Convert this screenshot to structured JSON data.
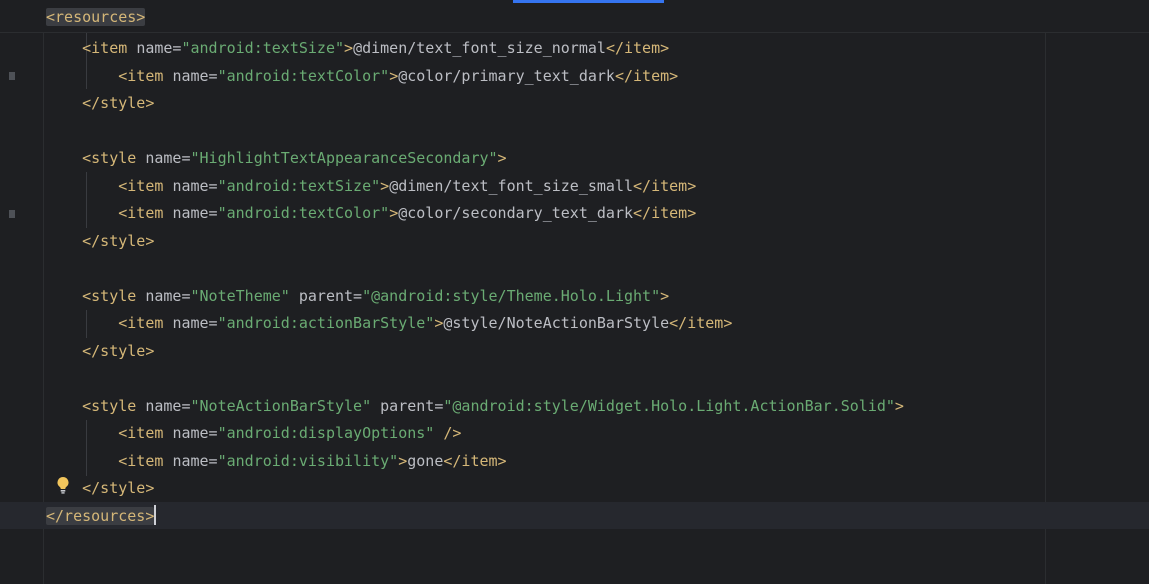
{
  "editor": {
    "header_line": [
      {
        "cls": "t tag-hl",
        "text": "<resources>"
      }
    ],
    "lines": [
      [
        {
          "cls": "x",
          "text": "    "
        },
        {
          "cls": "t",
          "text": "<item "
        },
        {
          "cls": "a",
          "text": "name="
        },
        {
          "cls": "v",
          "text": "\"android:textSize\""
        },
        {
          "cls": "t",
          "text": ">"
        },
        {
          "cls": "x",
          "text": "@dimen/text_font_size_normal"
        },
        {
          "cls": "t",
          "text": "</item>"
        }
      ],
      [
        {
          "cls": "x",
          "text": "        "
        },
        {
          "cls": "t",
          "text": "<item "
        },
        {
          "cls": "a",
          "text": "name="
        },
        {
          "cls": "v",
          "text": "\"android:textColor\""
        },
        {
          "cls": "t",
          "text": ">"
        },
        {
          "cls": "x",
          "text": "@color/primary_text_dark"
        },
        {
          "cls": "t",
          "text": "</item>"
        }
      ],
      [
        {
          "cls": "x",
          "text": "    "
        },
        {
          "cls": "t",
          "text": "</style>"
        }
      ],
      [],
      [
        {
          "cls": "x",
          "text": "    "
        },
        {
          "cls": "t",
          "text": "<style "
        },
        {
          "cls": "a",
          "text": "name="
        },
        {
          "cls": "v",
          "text": "\"HighlightTextAppearanceSecondary\""
        },
        {
          "cls": "t",
          "text": ">"
        }
      ],
      [
        {
          "cls": "x",
          "text": "        "
        },
        {
          "cls": "t",
          "text": "<item "
        },
        {
          "cls": "a",
          "text": "name="
        },
        {
          "cls": "v",
          "text": "\"android:textSize\""
        },
        {
          "cls": "t",
          "text": ">"
        },
        {
          "cls": "x",
          "text": "@dimen/text_font_size_small"
        },
        {
          "cls": "t",
          "text": "</item>"
        }
      ],
      [
        {
          "cls": "x",
          "text": "        "
        },
        {
          "cls": "t",
          "text": "<item "
        },
        {
          "cls": "a",
          "text": "name="
        },
        {
          "cls": "v",
          "text": "\"android:textColor\""
        },
        {
          "cls": "t",
          "text": ">"
        },
        {
          "cls": "x",
          "text": "@color/secondary_text_dark"
        },
        {
          "cls": "t",
          "text": "</item>"
        }
      ],
      [
        {
          "cls": "x",
          "text": "    "
        },
        {
          "cls": "t",
          "text": "</style>"
        }
      ],
      [],
      [
        {
          "cls": "x",
          "text": "    "
        },
        {
          "cls": "t",
          "text": "<style "
        },
        {
          "cls": "a",
          "text": "name="
        },
        {
          "cls": "v",
          "text": "\"NoteTheme\""
        },
        {
          "cls": "a",
          "text": " parent="
        },
        {
          "cls": "v",
          "text": "\"@android:style/Theme.Holo.Light\""
        },
        {
          "cls": "t",
          "text": ">"
        }
      ],
      [
        {
          "cls": "x",
          "text": "        "
        },
        {
          "cls": "t",
          "text": "<item "
        },
        {
          "cls": "a",
          "text": "name="
        },
        {
          "cls": "v",
          "text": "\"android:actionBarStyle\""
        },
        {
          "cls": "t",
          "text": ">"
        },
        {
          "cls": "x",
          "text": "@style/NoteActionBarStyle"
        },
        {
          "cls": "t",
          "text": "</item>"
        }
      ],
      [
        {
          "cls": "x",
          "text": "    "
        },
        {
          "cls": "t",
          "text": "</style>"
        }
      ],
      [],
      [
        {
          "cls": "x",
          "text": "    "
        },
        {
          "cls": "t",
          "text": "<style "
        },
        {
          "cls": "a",
          "text": "name="
        },
        {
          "cls": "v",
          "text": "\"NoteActionBarStyle\""
        },
        {
          "cls": "a",
          "text": " parent="
        },
        {
          "cls": "v",
          "text": "\"@android:style/Widget.Holo.Light.ActionBar.Solid\""
        },
        {
          "cls": "t",
          "text": ">"
        }
      ],
      [
        {
          "cls": "x",
          "text": "        "
        },
        {
          "cls": "t",
          "text": "<item "
        },
        {
          "cls": "a",
          "text": "name="
        },
        {
          "cls": "v",
          "text": "\"android:displayOptions\""
        },
        {
          "cls": "t",
          "text": " />"
        }
      ],
      [
        {
          "cls": "x",
          "text": "        "
        },
        {
          "cls": "t",
          "text": "<item "
        },
        {
          "cls": "a",
          "text": "name="
        },
        {
          "cls": "v",
          "text": "\"android:visibility\""
        },
        {
          "cls": "t",
          "text": ">"
        },
        {
          "cls": "x",
          "text": "gone"
        },
        {
          "cls": "t",
          "text": "</item>"
        }
      ],
      [
        {
          "cls": "x",
          "text": "    "
        },
        {
          "cls": "t",
          "text": "</style>"
        }
      ],
      [
        {
          "cls": "t tag-hl",
          "text": "</resources>"
        }
      ]
    ]
  },
  "colors": {
    "background": "#1e1f22",
    "tag": "#d5b778",
    "attribute": "#bcbec4",
    "string": "#6aab73",
    "accent": "#3574f0"
  },
  "icons": {
    "intention": "lightbulb-icon"
  }
}
